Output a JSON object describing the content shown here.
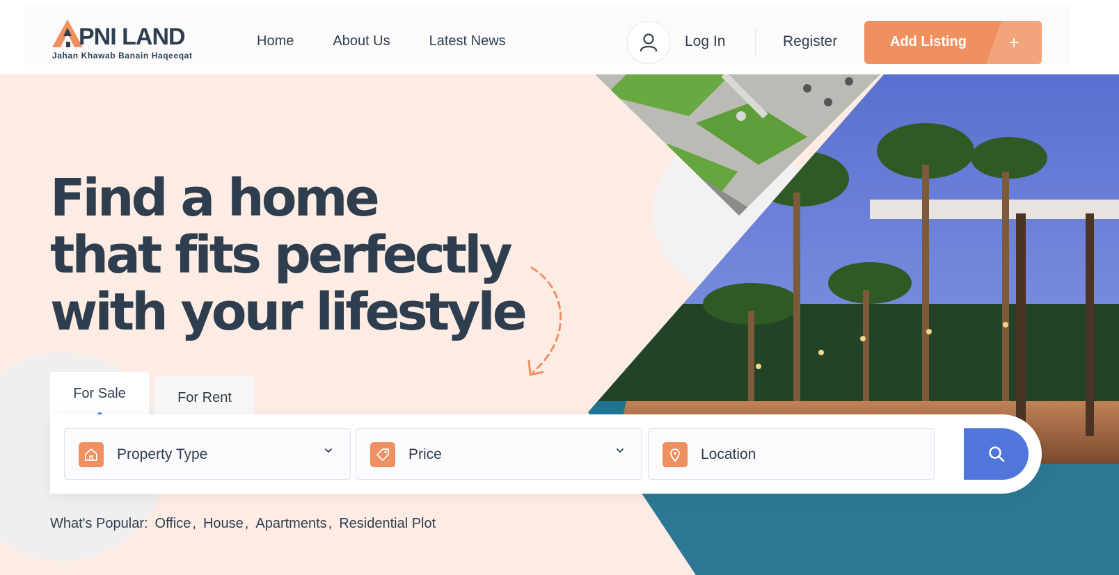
{
  "brand": {
    "name": "PNI LAND",
    "tagline": "Jahan Khawab Banain Haqeeqat"
  },
  "nav": {
    "items": [
      {
        "label": "Home"
      },
      {
        "label": "About Us"
      },
      {
        "label": "Latest News"
      }
    ]
  },
  "header": {
    "login_label": "Log In",
    "register_label": "Register",
    "add_listing_label": "Add Listing",
    "add_listing_plus": "+"
  },
  "hero": {
    "headline_line1": "Find a home",
    "headline_line2": "that fits perfectly",
    "headline_line3": "with your lifestyle"
  },
  "tabs": {
    "sale_label": "For Sale",
    "rent_label": "For Rent",
    "active": "For Sale"
  },
  "search": {
    "property_type_label": "Property Type",
    "price_label": "Price",
    "location_label": "Location"
  },
  "popular": {
    "label": "What's Popular:",
    "items": [
      "Office",
      "House",
      "Apartments",
      "Residential Plot"
    ]
  },
  "icons": {
    "user": "user-icon",
    "home": "home-icon",
    "tag": "tag-icon",
    "pin": "map-pin-icon",
    "search": "search-icon",
    "chevron": "chevron-down-icon"
  },
  "colors": {
    "accent": "#ef9060",
    "primary_blue": "#5076dc",
    "text_dark": "#2f3e4e",
    "hero_bg": "#fdece4"
  }
}
